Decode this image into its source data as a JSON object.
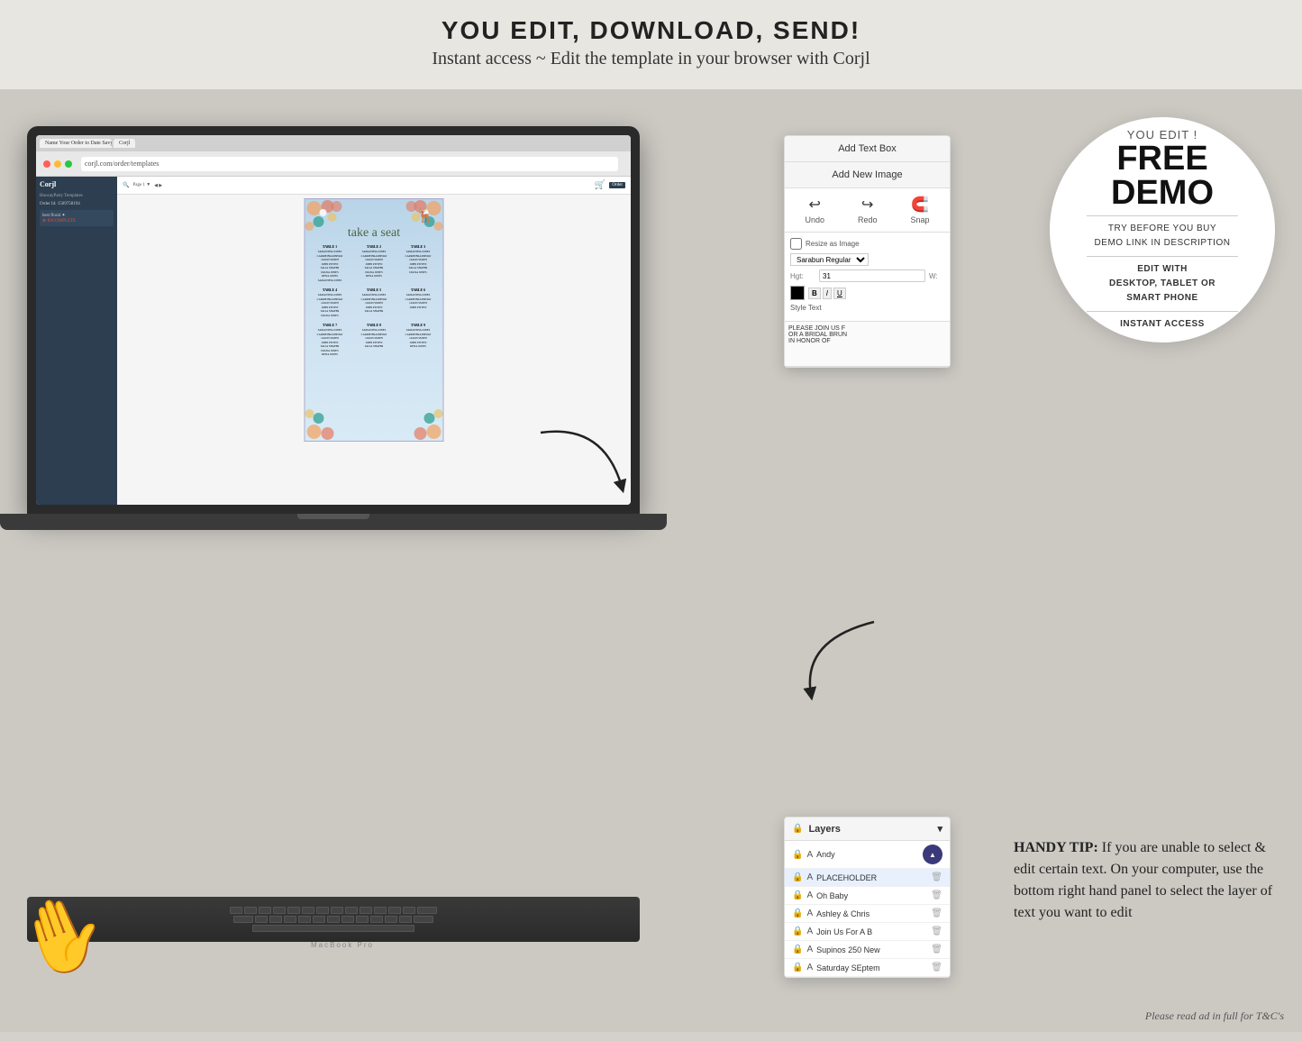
{
  "banner": {
    "headline": "YOU EDIT, DOWNLOAD, SEND!",
    "subheadline": "Instant access ~ Edit the template in your browser with Corjl"
  },
  "demo_circle": {
    "you_edit": "YOU EDIT !",
    "free": "FREE",
    "demo": "DEMO",
    "line1": "TRY BEFORE YOU BUY",
    "line2": "DEMO LINK IN DESCRIPTION",
    "line3": "EDIT WITH",
    "line4": "DESKTOP, TABLET OR",
    "line5": "SMART PHONE",
    "line6": "INSTANT ACCESS"
  },
  "edit_panel": {
    "btn1": "Add Text Box",
    "btn2": "Add New Image",
    "undo": "Undo",
    "redo": "Redo",
    "snap": "Snap",
    "style_text": "Style Text"
  },
  "layers_panel": {
    "header": "Layers",
    "layer1": "Oh Baby",
    "layer2": "Ashley & Chris",
    "layer3": "Join Us For A B",
    "layer4": "Supinos 250 New",
    "layer5": "Saturday SEptem"
  },
  "handy_tip": {
    "text": "HANDY TIP: If you are unable to select & edit certain text. On your computer, use the bottom right hand panel to select the layer of text you want to edit"
  },
  "seating_chart": {
    "title": "take a seat",
    "tables": [
      {
        "name": "TABLE 1",
        "names": [
          "SAMANTHA JONES",
          "CARRIE BRADSHAW",
          "JASON SMITH",
          "JOHN PITTEN",
          "TALIA SHAFER",
          "DIANA JONES",
          "DENA JONES",
          "SAMANTHA JONES"
        ]
      },
      {
        "name": "TABLE 2",
        "names": [
          "SAMANTHA JONES",
          "CARRIE BRADSHAW",
          "JASON SMITH",
          "JOHN PITTEN",
          "TALIA SHAFER",
          "DIANA JONES",
          "DENA JONES"
        ]
      },
      {
        "name": "TABLE 3",
        "names": [
          "SAMANTHA JONES",
          "CARRIE BRADSHAW",
          "JASON SMITH",
          "JOHN PITTEN",
          "TALIA SHAFER",
          "DIANA JONES"
        ]
      },
      {
        "name": "TABLE 4",
        "names": [
          "SAMANTHA JONES",
          "CARRIE BRADSHAW",
          "JASON SMITH",
          "JOHN PITTEN"
        ]
      },
      {
        "name": "TABLE 5",
        "names": [
          "SAMANTHA JONES",
          "CARRIE BRADSHAW",
          "JASON SMITH"
        ]
      },
      {
        "name": "TABLE 6",
        "names": [
          "SAMANTHA JONES",
          "CARRIE BRADSHAW"
        ]
      },
      {
        "name": "TABLE 7",
        "names": [
          "SAMANTHA JONES",
          "CARRIE BRADSHAW",
          "JASON SMITH"
        ]
      },
      {
        "name": "TABLE 8",
        "names": [
          "SAMANTHA JONES",
          "CARRIE BRADSHAW"
        ]
      },
      {
        "name": "TABLE 9",
        "names": [
          "SAMANTHA JONES",
          "CARRIE BRADSHAW",
          "JASON SMITH",
          "JOHN PITTEN"
        ]
      }
    ]
  },
  "footer": {
    "text": "Please read ad in full for T&C's"
  },
  "browser": {
    "address": "corjl.com/order/templates",
    "tab1": "Name Your Order to Date Savy...",
    "tab2": "Corjl"
  }
}
